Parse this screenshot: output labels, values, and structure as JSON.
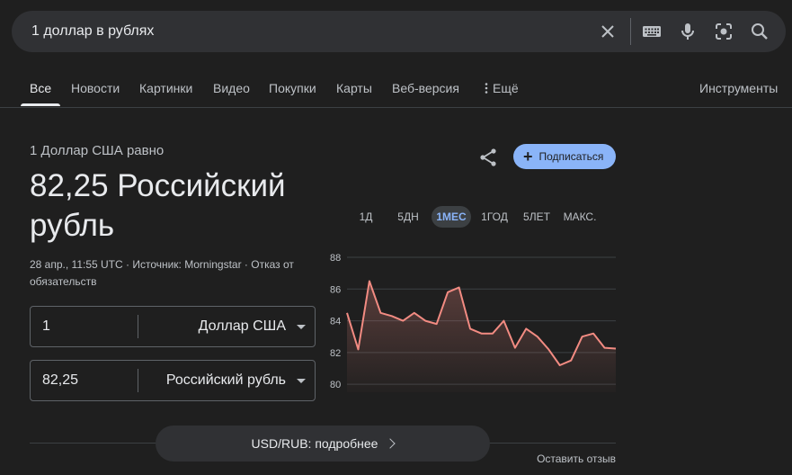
{
  "search": {
    "query": "1 доллар в рублях",
    "icons": [
      "clear-icon",
      "keyboard-icon",
      "mic-icon",
      "lens-icon",
      "search-icon"
    ]
  },
  "tabs": [
    {
      "label": "Все",
      "active": true
    },
    {
      "label": "Новости"
    },
    {
      "label": "Картинки"
    },
    {
      "label": "Видео"
    },
    {
      "label": "Покупки"
    },
    {
      "label": "Карты"
    },
    {
      "label": "Веб-версия"
    },
    {
      "label": "Ещё"
    },
    {
      "label": "Инструменты"
    }
  ],
  "converter": {
    "equal_label": "1 Доллар США равно",
    "result": "82,25 Российский рубль",
    "meta": "28 апр., 11:55 UTC · Источник: Morningstar · Отказ от обязательств",
    "from": {
      "value": "1",
      "currency": "Доллар США"
    },
    "to": {
      "value": "82,25",
      "currency": "Российский рубль"
    }
  },
  "subscribe_label": "Подписаться",
  "ranges": [
    {
      "label": "1Д"
    },
    {
      "label": "5ДН"
    },
    {
      "label": "1МЕС",
      "active": true
    },
    {
      "label": "1ГОД"
    },
    {
      "label": "5ЛЕТ"
    },
    {
      "label": "МАКС."
    }
  ],
  "chart_data": {
    "type": "line",
    "x": [
      1,
      2,
      3,
      4,
      5,
      6,
      7,
      8,
      9,
      10,
      11,
      12,
      13,
      14,
      15,
      16,
      17,
      18,
      19,
      20,
      21,
      22,
      23,
      24,
      25,
      26,
      27,
      28
    ],
    "series": [
      {
        "values": [
          84.5,
          82.2,
          86.5,
          84.5,
          84.3,
          84.0,
          84.5,
          84.0,
          83.8,
          85.8,
          86.1,
          83.5,
          83.2,
          83.2,
          84.0,
          82.3,
          83.5,
          83.0,
          82.2,
          81.2,
          81.5,
          83.0,
          83.2,
          82.3,
          82.25
        ]
      }
    ],
    "y_ticks": [
      "88",
      "86",
      "84",
      "82",
      "80"
    ],
    "ylim": [
      79.5,
      88
    ],
    "grid": true,
    "line_color": "#f28b82"
  },
  "details_label": "USD/RUB: подробнее",
  "feedback_label": "Оставить отзыв"
}
